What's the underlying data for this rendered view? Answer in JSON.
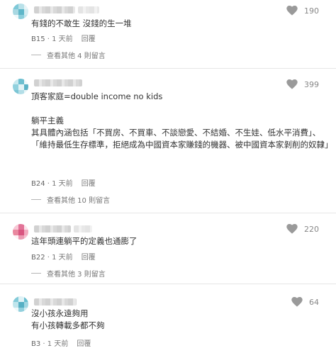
{
  "colors": {
    "text": "#333333",
    "meta": "#777777",
    "heart": "#9a9a9a",
    "separator": "#e6e6e6"
  },
  "icons": {
    "like": "heart-icon",
    "avatar": "pixel-avatar"
  },
  "comments": [
    {
      "likes": "190",
      "text": "有錢的不敢生 沒錢的生一堆",
      "floor": "B15",
      "time": "1 天前",
      "reply_label": "回覆",
      "view_replies": "查看其他 4 則留言"
    },
    {
      "likes": "399",
      "text": "頂客家庭=double income no kids\n\n躺平主義\n其具體內涵包括「不買房、不買車、不談戀愛、不結婚、不生娃、低水平消費」、「維持最低生存標準，拒絕成為中國資本家賺錢的機器、被中國資本家剝削的奴隸」",
      "floor": "B24",
      "time": "1 天前",
      "reply_label": "回覆",
      "view_replies": "查看其他 10 則留言"
    },
    {
      "likes": "220",
      "text": "這年頭連躺平的定義也通膨了",
      "floor": "B22",
      "time": "1 天前",
      "reply_label": "回覆",
      "view_replies": "查看其他 3 則留言"
    },
    {
      "likes": "64",
      "text": "沒小孩永遠夠用\n有小孩轉載多都不夠",
      "floor": "B3",
      "time": "1 天前",
      "reply_label": "回覆"
    }
  ]
}
